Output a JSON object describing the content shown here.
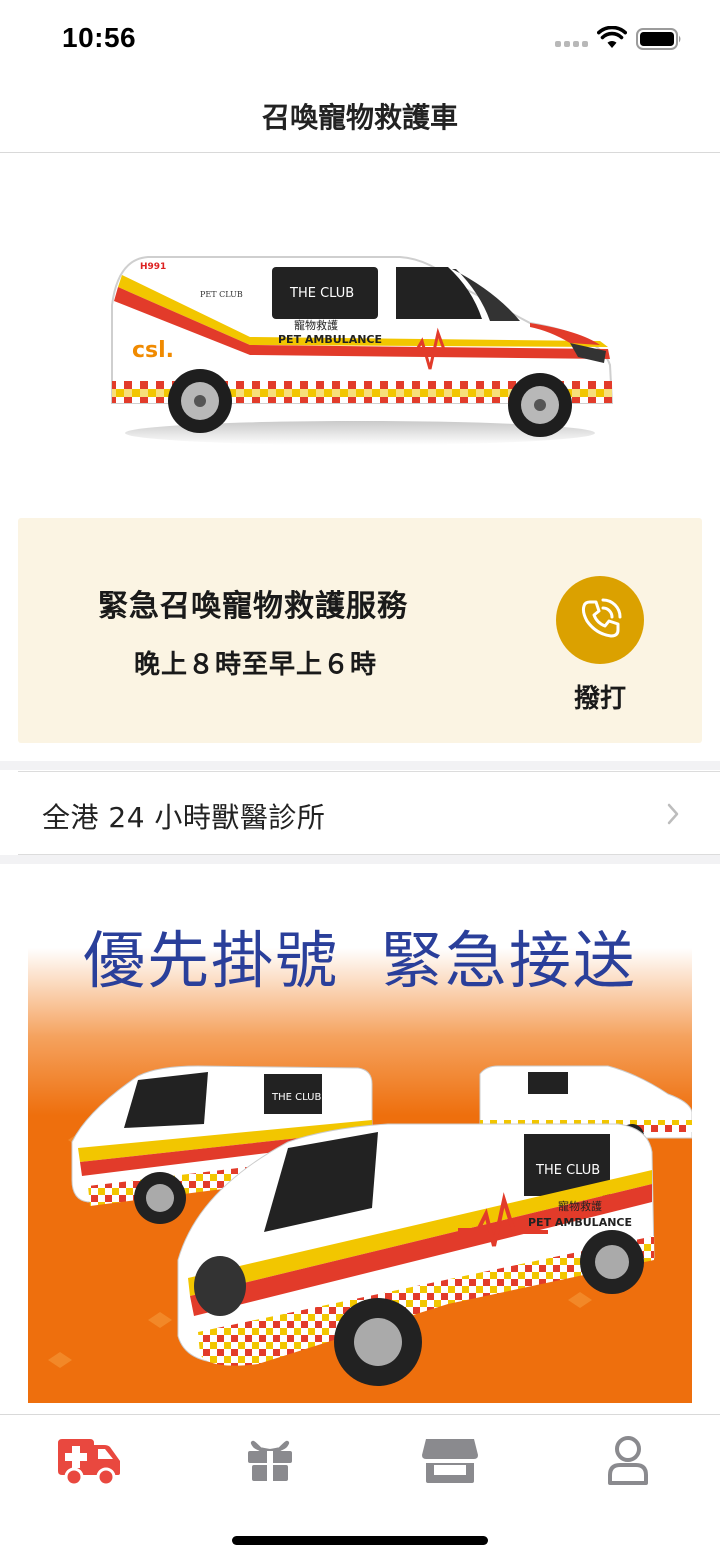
{
  "status": {
    "time": "10:56"
  },
  "nav": {
    "title": "召喚寵物救護車"
  },
  "hero_van": {
    "plate_label": "H991",
    "brand_label": "csl.",
    "window_label": "THE CLUB",
    "side_label_zh": "寵物救護",
    "side_label_en": "PET AMBULANCE",
    "club_label": "PET CLUB"
  },
  "emergency": {
    "title": "緊急召喚寵物救護服務",
    "hours": "晚上８時至早上６時",
    "call_label": "撥打",
    "accent_color": "#dba100",
    "background_color": "#fbf4e3"
  },
  "clinic_row": {
    "label": "全港 24 小時獸醫診所"
  },
  "banner": {
    "heading": "優先掛號 緊急接送",
    "van_window_label": "THE CLUB",
    "van_side_label_zh": "寵物救護",
    "van_side_label_en": "PET AMBULANCE",
    "background_color": "#ee6f0d",
    "heading_color": "#2a3f9a"
  },
  "tabs": [
    {
      "icon": "ambulance-icon",
      "active": true,
      "color": "#e9483f"
    },
    {
      "icon": "gift-icon",
      "active": false,
      "color": "#8a8a8e"
    },
    {
      "icon": "store-icon",
      "active": false,
      "color": "#8a8a8e"
    },
    {
      "icon": "profile-icon",
      "active": false,
      "color": "#8a8a8e"
    }
  ]
}
